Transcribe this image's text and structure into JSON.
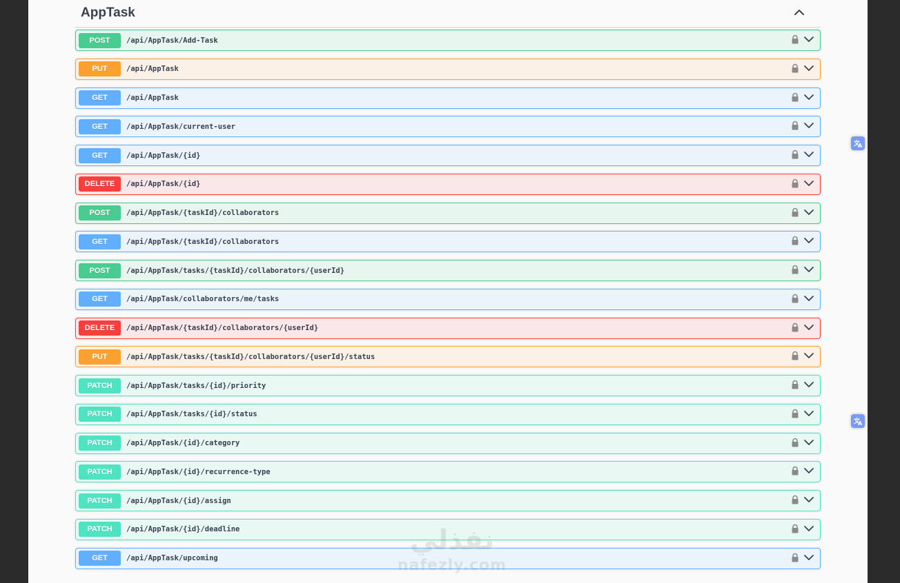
{
  "section": {
    "title": "AppTask",
    "toggle_icon": "chevron-up-icon"
  },
  "operations": [
    {
      "method": "POST",
      "path": "/api/AppTask/Add-Task"
    },
    {
      "method": "PUT",
      "path": "/api/AppTask"
    },
    {
      "method": "GET",
      "path": "/api/AppTask"
    },
    {
      "method": "GET",
      "path": "/api/AppTask/current-user"
    },
    {
      "method": "GET",
      "path": "/api/AppTask/{id}"
    },
    {
      "method": "DELETE",
      "path": "/api/AppTask/{id}"
    },
    {
      "method": "POST",
      "path": "/api/AppTask/{taskId}/collaborators"
    },
    {
      "method": "GET",
      "path": "/api/AppTask/{taskId}/collaborators"
    },
    {
      "method": "POST",
      "path": "/api/AppTask/tasks/{taskId}/collaborators/{userId}"
    },
    {
      "method": "GET",
      "path": "/api/AppTask/collaborators/me/tasks"
    },
    {
      "method": "DELETE",
      "path": "/api/AppTask/{taskId}/collaborators/{userId}"
    },
    {
      "method": "PUT",
      "path": "/api/AppTask/tasks/{taskId}/collaborators/{userId}/status"
    },
    {
      "method": "PATCH",
      "path": "/api/AppTask/tasks/{id}/priority"
    },
    {
      "method": "PATCH",
      "path": "/api/AppTask/tasks/{id}/status"
    },
    {
      "method": "PATCH",
      "path": "/api/AppTask/{id}/category"
    },
    {
      "method": "PATCH",
      "path": "/api/AppTask/{id}/recurrence-type"
    },
    {
      "method": "PATCH",
      "path": "/api/AppTask/{id}/assign"
    },
    {
      "method": "PATCH",
      "path": "/api/AppTask/{id}/deadline"
    },
    {
      "method": "GET",
      "path": "/api/AppTask/upcoming"
    }
  ],
  "row_icons": {
    "lock": "lock-icon",
    "expand": "chevron-down-icon"
  },
  "method_colors": {
    "POST": "#49cc90",
    "PUT": "#fca130",
    "GET": "#61affe",
    "DELETE": "#f93e3e",
    "PATCH": "#50e3c2"
  },
  "watermark": {
    "arabic": "نفذلي",
    "latin": "nafezly.com"
  },
  "side_icons": [
    "translate-icon",
    "translate-icon"
  ]
}
